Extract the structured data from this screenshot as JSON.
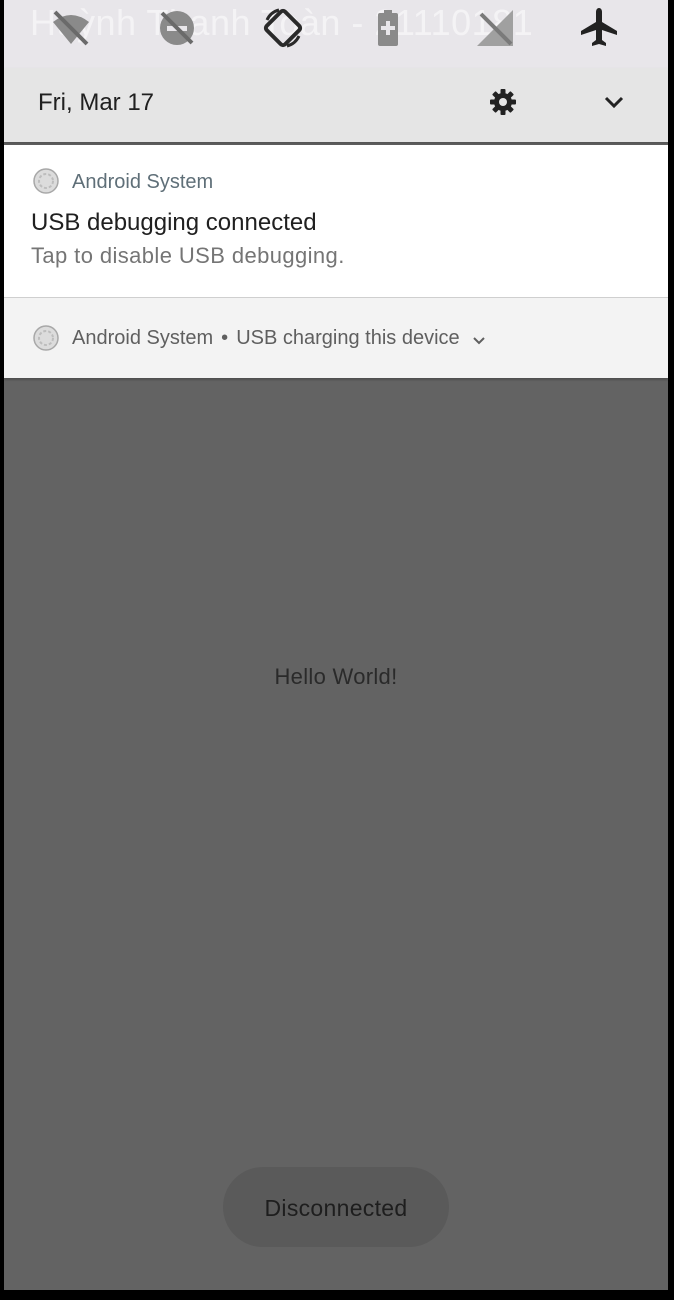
{
  "quick_settings": {
    "ghost_text": "Huỳnh Thanh Toàn - 21110181",
    "tiles": [
      {
        "icon": "wifi-off-icon"
      },
      {
        "icon": "do-not-disturb-icon"
      },
      {
        "icon": "auto-rotate-icon"
      },
      {
        "icon": "battery-saver-icon"
      },
      {
        "icon": "mobile-data-off-icon"
      },
      {
        "icon": "airplane-mode-icon"
      }
    ]
  },
  "header": {
    "date": "Fri, Mar 17",
    "settings_icon": "gear-icon",
    "expand_icon": "chevron-down-icon"
  },
  "notifications": [
    {
      "app": "Android System",
      "title": "USB debugging connected",
      "text": "Tap to disable USB debugging."
    },
    {
      "app": "Android System",
      "separator": "•",
      "text": "USB charging this device"
    }
  ],
  "app": {
    "hello_text": "Hello World!",
    "toast_text": "Disconnected"
  },
  "colors": {
    "scrim": "#636363",
    "shade_header": "#e5e5e5",
    "notification_bg": "#ffffff"
  }
}
